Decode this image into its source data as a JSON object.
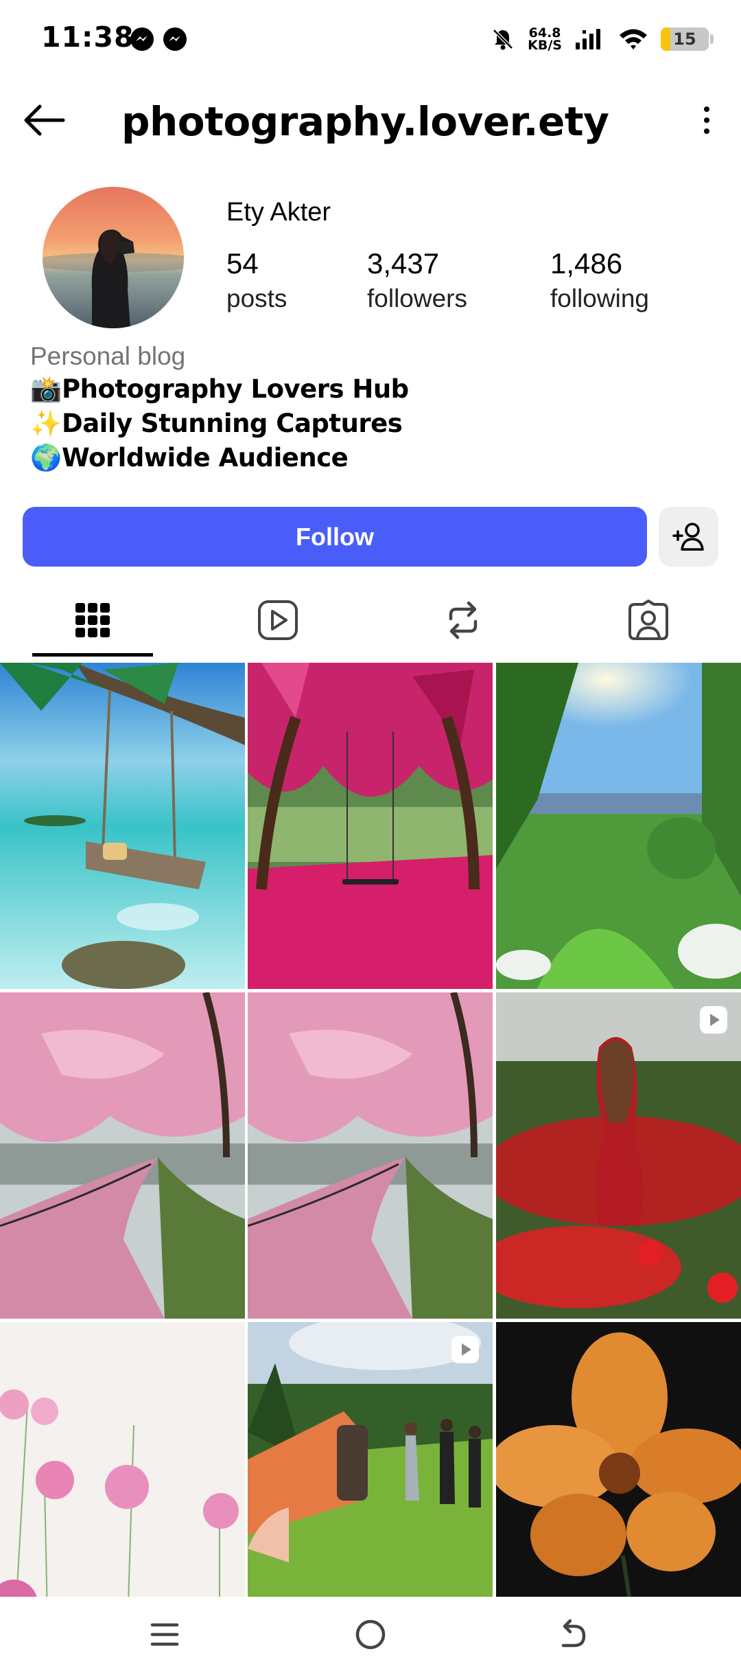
{
  "status_bar": {
    "time": "11:38",
    "net_speed_value": "64.8",
    "net_speed_unit": "KB/S",
    "battery_level": "15",
    "battery_color": "#f7c30f"
  },
  "header": {
    "username": "photography.lover.ety",
    "back_icon": "arrow-left-icon",
    "more_icon": "more-vertical-icon"
  },
  "profile": {
    "display_name": "Ety Akter",
    "stats": [
      {
        "value": "54",
        "label": "posts"
      },
      {
        "value": "3,437",
        "label": "followers"
      },
      {
        "value": "1,486",
        "label": "following"
      }
    ],
    "category": "Personal blog",
    "bio": [
      {
        "emoji": "📸",
        "text": "Photography Lovers Hub"
      },
      {
        "emoji": "✨",
        "text": "Daily Stunning Captures"
      },
      {
        "emoji": "🌍",
        "text": "Worldwide Audience"
      }
    ]
  },
  "actions": {
    "follow_label": "Follow",
    "follow_color": "#4a5df9",
    "suggest_icon": "add-person-icon"
  },
  "tabs": [
    {
      "name": "posts",
      "icon": "grid-icon",
      "active": true
    },
    {
      "name": "reels",
      "icon": "reels-icon",
      "active": false
    },
    {
      "name": "reposts",
      "icon": "repost-icon",
      "active": false
    },
    {
      "name": "tagged",
      "icon": "tagged-icon",
      "active": false
    }
  ],
  "grid": [
    {
      "subject": "swing over tropical lagoon",
      "reel": false
    },
    {
      "subject": "swing under pink blossom trees",
      "reel": false
    },
    {
      "subject": "sunlit green park",
      "reel": false
    },
    {
      "subject": "cherry blossom lakeside path",
      "reel": false
    },
    {
      "subject": "cherry blossom lakeside path",
      "reel": false
    },
    {
      "subject": "woman in red poppy field",
      "reel": true
    },
    {
      "subject": "pink cosmos flowers",
      "reel": false
    },
    {
      "subject": "people in meadow with cup",
      "reel": true
    },
    {
      "subject": "orange flower with dew",
      "reel": false
    }
  ],
  "navbar": {
    "icons": [
      "menu-icon",
      "home-circle-icon",
      "back-nav-icon"
    ]
  }
}
